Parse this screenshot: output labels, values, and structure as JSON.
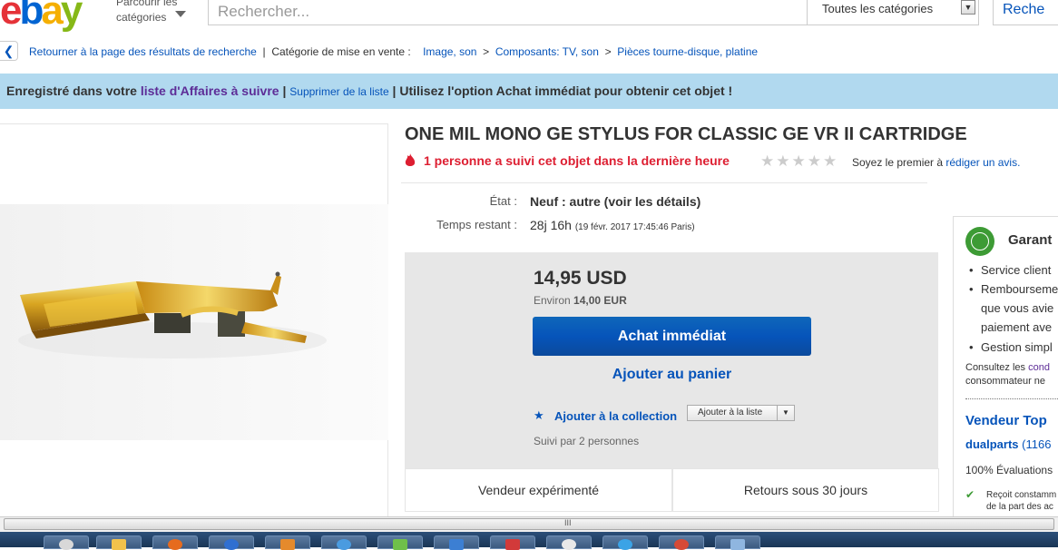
{
  "header": {
    "logo": [
      "e",
      "b",
      "a",
      "y"
    ],
    "browse_label": "Parcourir les catégories",
    "search_placeholder": "Rechercher...",
    "category_select": "Toutes les catégories",
    "search_button": "Reche"
  },
  "breadcrumb": {
    "back": "Retourner à la page des résultats de recherche",
    "category_label": "Catégorie de mise en vente :",
    "items": [
      "Image, son",
      "Composants: TV, son",
      "Pièces tourne-disque, platine"
    ]
  },
  "banner": {
    "prefix": "Enregistré dans votre",
    "watchlist_link": "liste d'Affaires à suivre",
    "remove_link": "Supprimer de la liste",
    "message": "Utilisez l'option Achat immédiat pour obtenir cet objet !"
  },
  "item": {
    "title": "ONE MIL MONO GE STYLUS FOR CLASSIC GE VR II CARTRIDGE",
    "hot_text": "1 personne a suivi cet objet dans la dernière heure",
    "stars": "★★★★★",
    "review_prefix": "Soyez le premier à",
    "review_link": "rédiger un avis.",
    "condition_label": "État :",
    "condition_value": "Neuf : autre (voir les détails)",
    "time_label": "Temps restant :",
    "time_value": "28j 16h",
    "time_end": "(19 févr. 2017   17:45:46 Paris)"
  },
  "buy": {
    "price": "14,95 USD",
    "approx_prefix": "Environ",
    "approx_value": "14,00 EUR",
    "buy_now": "Achat immédiat",
    "add_cart": "Ajouter au panier",
    "add_collection": "Ajouter à la collection",
    "add_list": "Ajouter à la liste",
    "followed": "Suivi par 2 personnes",
    "feature1": "Vendeur expérimenté",
    "feature2": "Retours sous 30 jours"
  },
  "panel": {
    "guarantee": "Garant",
    "bullets": [
      "Service client",
      "Rembourseme",
      "que vous avie",
      "paiement ave",
      "Gestion simpl"
    ],
    "consult_line1": "Consultez les",
    "consult_link": "cond",
    "consult_line2": "consommateur ne",
    "top_seller": "Vendeur Top",
    "seller_name": "dualparts",
    "seller_count": "(1166",
    "evaluations": "100% Évaluations",
    "receive_line1": "Reçoit constamm",
    "receive_line2": "de la part des ac"
  },
  "scrollbar": {
    "grip": "III"
  },
  "colors": {
    "link": "#0654ba",
    "banner": "#b1d9ef",
    "hot": "#dd1e31",
    "buy_button": "#0654ba"
  }
}
